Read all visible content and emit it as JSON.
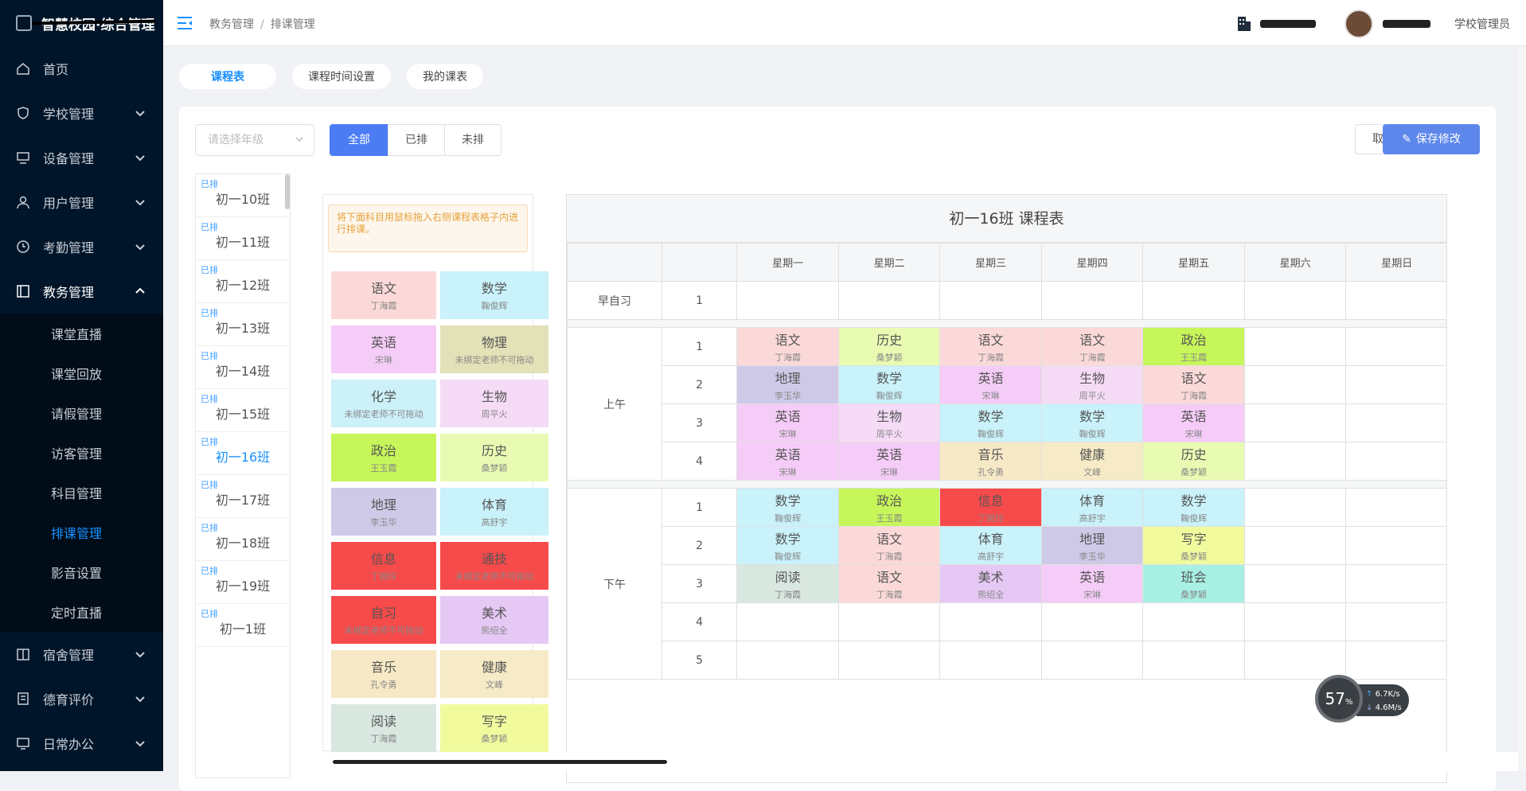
{
  "brand": {
    "title": "智慧校园·综合管理"
  },
  "menu": [
    {
      "label": "首页",
      "icon": "home-icon",
      "expandable": false
    },
    {
      "label": "学校管理",
      "icon": "shield-icon",
      "expandable": true
    },
    {
      "label": "设备管理",
      "icon": "device-icon",
      "expandable": true
    },
    {
      "label": "用户管理",
      "icon": "user-icon",
      "expandable": true
    },
    {
      "label": "考勤管理",
      "icon": "clock-icon",
      "expandable": true
    },
    {
      "label": "教务管理",
      "icon": "book-icon",
      "expandable": true,
      "open": true
    }
  ],
  "submenu": [
    "课堂直播",
    "课堂回放",
    "请假管理",
    "访客管理",
    "科目管理",
    "排课管理",
    "影音设置",
    "定时直播"
  ],
  "submenu_active": "排课管理",
  "menu_after": [
    {
      "label": "宿舍管理",
      "icon": "dorm-icon"
    },
    {
      "label": "德育评价",
      "icon": "award-icon"
    },
    {
      "label": "日常办公",
      "icon": "monitor-icon"
    }
  ],
  "breadcrumb": {
    "part1": "教务管理",
    "sep": "/",
    "part2": "排课管理"
  },
  "header": {
    "role": "学校管理员"
  },
  "tabs": [
    "课程表",
    "课程时间设置",
    "我的课表"
  ],
  "grade_select": {
    "placeholder": "请选择年级"
  },
  "filters": [
    "全部",
    "已排",
    "未排"
  ],
  "actions": {
    "cancel": "取消",
    "save": "保存修改"
  },
  "classes": [
    {
      "status": "已排",
      "name": "初一10班"
    },
    {
      "status": "已排",
      "name": "初一11班"
    },
    {
      "status": "已排",
      "name": "初一12班"
    },
    {
      "status": "已排",
      "name": "初一13班"
    },
    {
      "status": "已排",
      "name": "初一14班"
    },
    {
      "status": "已排",
      "name": "初一15班"
    },
    {
      "status": "已排",
      "name": "初一16班",
      "active": true
    },
    {
      "status": "已排",
      "name": "初一17班"
    },
    {
      "status": "已排",
      "name": "初一18班"
    },
    {
      "status": "已排",
      "name": "初一19班"
    },
    {
      "status": "已排",
      "name": "初一1班"
    }
  ],
  "hint": "将下面科目用鼠标拖入右侧课程表格子内进行排课。",
  "subjects": [
    {
      "name": "语文",
      "teacher": "丁海霞",
      "color": "#fcd9d9"
    },
    {
      "name": "数学",
      "teacher": "鞠俊辉",
      "color": "#c9f2fb"
    },
    {
      "name": "英语",
      "teacher": "宋琳",
      "color": "#f5ccf7"
    },
    {
      "name": "物理",
      "teacher": "未绑定老师不可拖动",
      "color": "#e2e1b7"
    },
    {
      "name": "化学",
      "teacher": "未绑定老师不可拖动",
      "color": "#ccf1f9"
    },
    {
      "name": "生物",
      "teacher": "周平火",
      "color": "#f6dbf6"
    },
    {
      "name": "政治",
      "teacher": "王玉霞",
      "color": "#c6f65a"
    },
    {
      "name": "历史",
      "teacher": "桑梦颖",
      "color": "#e9fbb2"
    },
    {
      "name": "地理",
      "teacher": "李玉华",
      "color": "#cfc9e8"
    },
    {
      "name": "体育",
      "teacher": "高舒宇",
      "color": "#c9f2fb"
    },
    {
      "name": "信息",
      "teacher": "丁婉玲",
      "color": "#f74a4a"
    },
    {
      "name": "通技",
      "teacher": "未绑定老师不可拖动",
      "color": "#f74a4a"
    },
    {
      "name": "自习",
      "teacher": "未绑定老师不可拖动",
      "color": "#f74a4a"
    },
    {
      "name": "美术",
      "teacher": "熊绍全",
      "color": "#e6c8f4"
    },
    {
      "name": "音乐",
      "teacher": "孔令勇",
      "color": "#f7e8c6"
    },
    {
      "name": "健康",
      "teacher": "文峰",
      "color": "#f6ebc6"
    },
    {
      "name": "阅读",
      "teacher": "丁海霞",
      "color": "#d8e7df"
    },
    {
      "name": "写字",
      "teacher": "桑梦颖",
      "color": "#f1fb9e"
    }
  ],
  "timetable": {
    "title": "初一16班 课程表",
    "days": [
      "星期一",
      "星期二",
      "星期三",
      "星期四",
      "星期五",
      "星期六",
      "星期日"
    ],
    "early": {
      "label": "早自习",
      "period": "1"
    },
    "morning": {
      "label": "上午",
      "rows": [
        {
          "p": "1",
          "cells": [
            [
              "语文",
              "丁海霞",
              "#fcd9d9"
            ],
            [
              "历史",
              "桑梦颖",
              "#e9fbb2"
            ],
            [
              "语文",
              "丁海霞",
              "#fcd9d9"
            ],
            [
              "语文",
              "丁海霞",
              "#fcd9d9"
            ],
            [
              "政治",
              "王玉霞",
              "#c6f65a"
            ],
            null,
            null
          ]
        },
        {
          "p": "2",
          "cells": [
            [
              "地理",
              "李玉华",
              "#cfc9e8"
            ],
            [
              "数学",
              "鞠俊辉",
              "#c9f2fb"
            ],
            [
              "英语",
              "宋琳",
              "#f5ccf7"
            ],
            [
              "生物",
              "周平火",
              "#f6dbf6"
            ],
            [
              "语文",
              "丁海霞",
              "#fcd9d9"
            ],
            null,
            null
          ]
        },
        {
          "p": "3",
          "cells": [
            [
              "英语",
              "宋琳",
              "#f5ccf7"
            ],
            [
              "生物",
              "周平火",
              "#f6dbf6"
            ],
            [
              "数学",
              "鞠俊辉",
              "#c9f2fb"
            ],
            [
              "数学",
              "鞠俊辉",
              "#c9f2fb"
            ],
            [
              "英语",
              "宋琳",
              "#f5ccf7"
            ],
            null,
            null
          ]
        },
        {
          "p": "4",
          "cells": [
            [
              "英语",
              "宋琳",
              "#f5ccf7"
            ],
            [
              "英语",
              "宋琳",
              "#f5ccf7"
            ],
            [
              "音乐",
              "孔令勇",
              "#f7e8c6"
            ],
            [
              "健康",
              "文峰",
              "#f6ebc6"
            ],
            [
              "历史",
              "桑梦颖",
              "#e9fbb2"
            ],
            null,
            null
          ]
        }
      ]
    },
    "afternoon": {
      "label": "下午",
      "rows": [
        {
          "p": "1",
          "cells": [
            [
              "数学",
              "鞠俊辉",
              "#c9f2fb"
            ],
            [
              "政治",
              "王玉霞",
              "#c6f65a"
            ],
            [
              "信息",
              "丁婉玲",
              "#f74a4a"
            ],
            [
              "体育",
              "高舒宇",
              "#c9f2fb"
            ],
            [
              "数学",
              "鞠俊辉",
              "#c9f2fb"
            ],
            null,
            null
          ]
        },
        {
          "p": "2",
          "cells": [
            [
              "数学",
              "鞠俊辉",
              "#c9f2fb"
            ],
            [
              "语文",
              "丁海霞",
              "#fcd9d9"
            ],
            [
              "体育",
              "高舒宇",
              "#c9f2fb"
            ],
            [
              "地理",
              "李玉华",
              "#cfc9e8"
            ],
            [
              "写字",
              "桑梦颖",
              "#f1fb9e"
            ],
            null,
            null
          ]
        },
        {
          "p": "3",
          "cells": [
            [
              "阅读",
              "丁海霞",
              "#d8e7df"
            ],
            [
              "语文",
              "丁海霞",
              "#fcd9d9"
            ],
            [
              "美术",
              "熊绍全",
              "#e6c8f4"
            ],
            [
              "英语",
              "宋琳",
              "#f5ccf7"
            ],
            [
              "班会",
              "桑梦颖",
              "#a8f0e4"
            ],
            null,
            null
          ]
        },
        {
          "p": "4",
          "cells": [
            null,
            null,
            null,
            null,
            null,
            null,
            null
          ]
        },
        {
          "p": "5",
          "cells": [
            null,
            null,
            null,
            null,
            null,
            null,
            null
          ]
        }
      ]
    }
  },
  "netmon": {
    "percent": "57",
    "unit": "%",
    "up": "6.7",
    "up_unit": "K/s",
    "down": "4.6",
    "down_unit": "M/s"
  }
}
